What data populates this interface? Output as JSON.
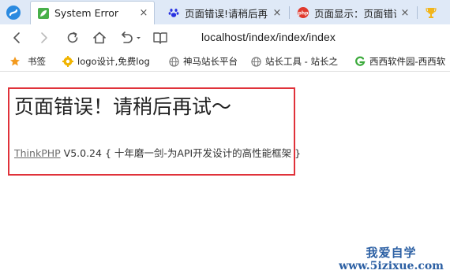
{
  "browser": {
    "tabs": [
      {
        "title": "System Error",
        "close": "×",
        "active": true
      },
      {
        "title": "页面错误!请稍后再",
        "close": "×",
        "active": false
      },
      {
        "title": "页面显示：页面错误",
        "close": "×",
        "active": false
      }
    ],
    "address": "localhost/index/index/index",
    "bookmarks": [
      {
        "label": "书签"
      },
      {
        "label": "logo设计,免费log"
      },
      {
        "label": "神马站长平台"
      },
      {
        "label": "站长工具 - 站长之"
      },
      {
        "label": "西西软件园-西西软"
      }
    ]
  },
  "page": {
    "heading": "页面错误！请稍后再试～",
    "framework_link": "ThinkPHP",
    "version": "V5.0.24",
    "slogan": "{ 十年磨一剑-为API开发设计的高性能框架 }"
  },
  "watermark": {
    "text_cn": "我爱自学",
    "url": "www.5izixue.com"
  },
  "colors": {
    "highlight_border": "#e0323a",
    "tabstrip_bg": "#dfe9f7",
    "watermark": "#2b5fa3"
  }
}
